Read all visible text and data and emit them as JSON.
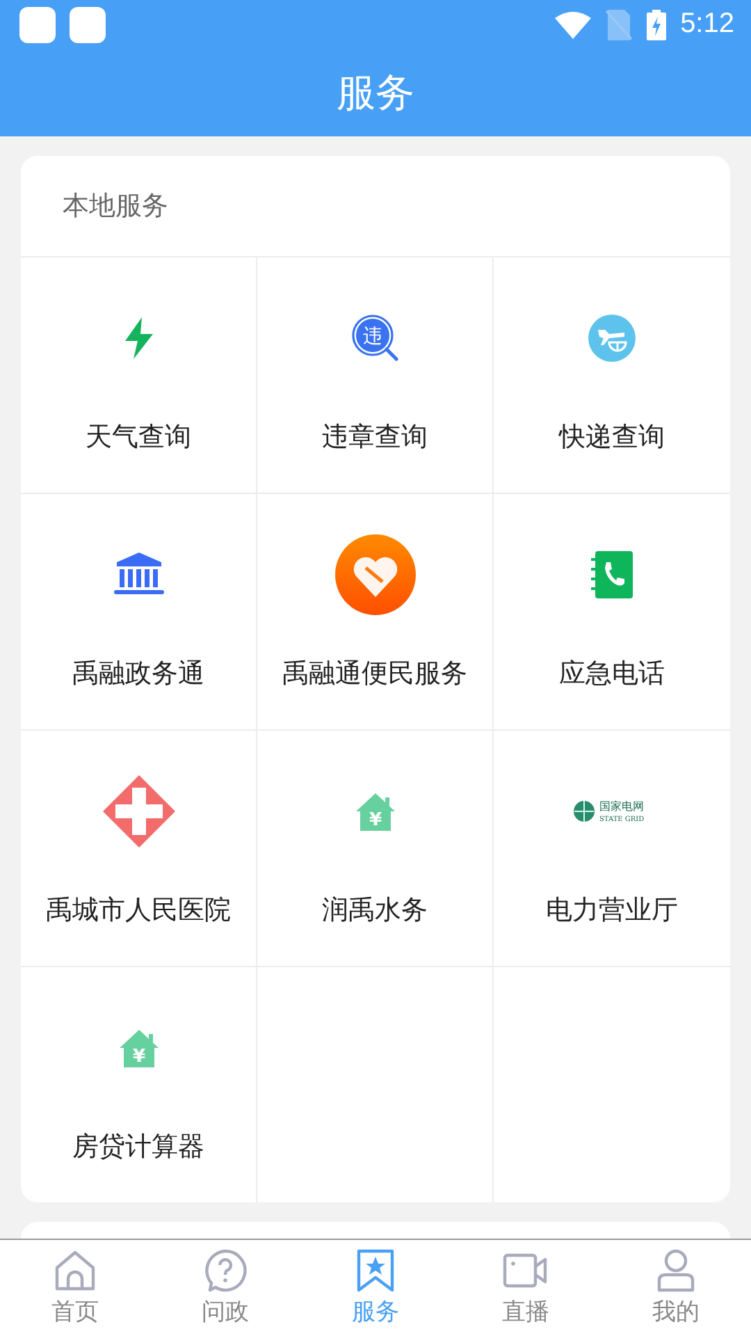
{
  "status_bar": {
    "time": "5:12"
  },
  "header": {
    "title": "服务"
  },
  "local_services": {
    "title": "本地服务",
    "items": [
      {
        "label": "天气查询",
        "kind": "bolt"
      },
      {
        "label": "违章查询",
        "kind": "violation",
        "icon_text": "违"
      },
      {
        "label": "快递查询",
        "kind": "express"
      },
      {
        "label": "禹融政务通",
        "kind": "bank"
      },
      {
        "label": "禹融通便民服务",
        "kind": "heart"
      },
      {
        "label": "应急电话",
        "kind": "phone"
      },
      {
        "label": "禹城市人民医院",
        "kind": "hospital"
      },
      {
        "label": "润禹水务",
        "kind": "house",
        "icon_text": "¥"
      },
      {
        "label": "电力营业厅",
        "kind": "grid",
        "icon_text": "国家电网",
        "icon_subtext": "STATE GRID"
      },
      {
        "label": "房贷计算器",
        "kind": "house",
        "icon_text": "¥"
      }
    ]
  },
  "bottom_nav": [
    {
      "label": "首页",
      "kind": "home",
      "selected": false
    },
    {
      "label": "问政",
      "kind": "question",
      "selected": false
    },
    {
      "label": "服务",
      "kind": "bookmark",
      "selected": true
    },
    {
      "label": "直播",
      "kind": "camera",
      "selected": false
    },
    {
      "label": "我的",
      "kind": "person",
      "selected": false
    }
  ]
}
